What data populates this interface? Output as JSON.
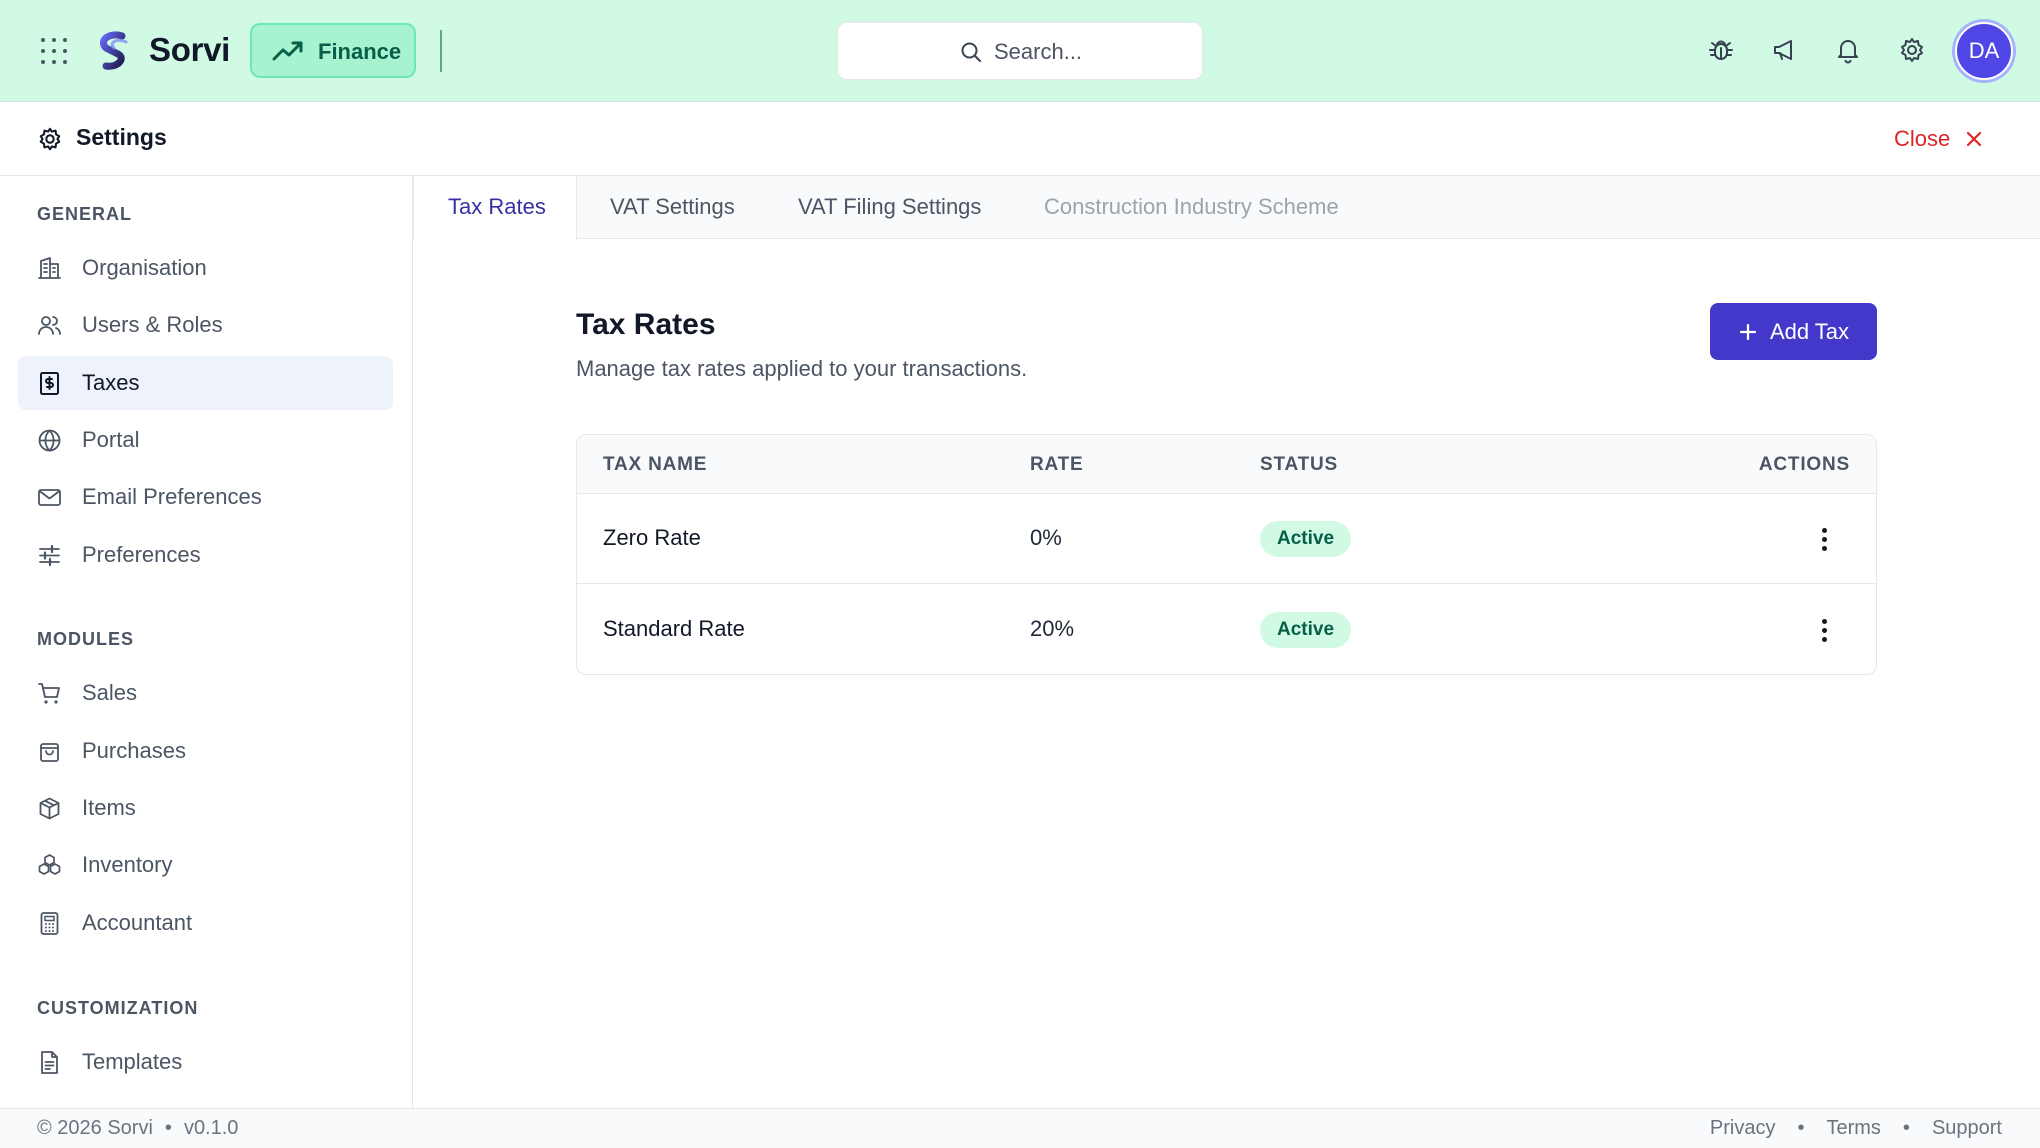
{
  "app": {
    "brand": "Sorvi",
    "module": "Finance",
    "search_placeholder": "Search...",
    "avatar_initials": "DA",
    "colors": {
      "topbar": "#d1fae5",
      "accent": "#4338ca",
      "active_tab": "#3730a3",
      "close": "#dc2626",
      "badge_bg": "#d1fae5",
      "badge_text": "#065f46"
    }
  },
  "top_icons": [
    "bug-icon",
    "megaphone-icon",
    "bell-icon",
    "gear-icon"
  ],
  "settings": {
    "title": "Settings",
    "close_label": "Close"
  },
  "sidebar": {
    "sections": [
      {
        "label": "GENERAL",
        "items": [
          {
            "label": "Organisation",
            "icon": "building-icon"
          },
          {
            "label": "Users & Roles",
            "icon": "users-icon"
          },
          {
            "label": "Taxes",
            "icon": "receipt-dollar-icon",
            "active": true
          },
          {
            "label": "Portal",
            "icon": "globe-icon"
          },
          {
            "label": "Email Preferences",
            "icon": "mail-icon"
          },
          {
            "label": "Preferences",
            "icon": "sliders-icon"
          }
        ]
      },
      {
        "label": "MODULES",
        "items": [
          {
            "label": "Sales",
            "icon": "cart-icon"
          },
          {
            "label": "Purchases",
            "icon": "shopping-bag-icon"
          },
          {
            "label": "Items",
            "icon": "package-icon"
          },
          {
            "label": "Inventory",
            "icon": "boxes-icon"
          },
          {
            "label": "Accountant",
            "icon": "calculator-icon"
          }
        ]
      },
      {
        "label": "CUSTOMIZATION",
        "items": [
          {
            "label": "Templates",
            "icon": "document-icon"
          }
        ]
      }
    ]
  },
  "tabs": [
    {
      "label": "Tax Rates",
      "active": true
    },
    {
      "label": "VAT Settings"
    },
    {
      "label": "VAT Filing Settings"
    },
    {
      "label": "Construction Industry Scheme",
      "disabled": true
    }
  ],
  "main": {
    "title": "Tax Rates",
    "subtitle": "Manage tax rates applied to your transactions.",
    "add_label": "Add Tax",
    "table": {
      "headers": [
        "TAX NAME",
        "RATE",
        "STATUS",
        "ACTIONS"
      ],
      "rows": [
        {
          "name": "Zero Rate",
          "rate": "0%",
          "status": "Active"
        },
        {
          "name": "Standard Rate",
          "rate": "20%",
          "status": "Active"
        }
      ]
    }
  },
  "footer": {
    "copyright": "© 2026 Sorvi",
    "version": "v0.1.0",
    "links": [
      "Privacy",
      "Terms",
      "Support"
    ]
  }
}
